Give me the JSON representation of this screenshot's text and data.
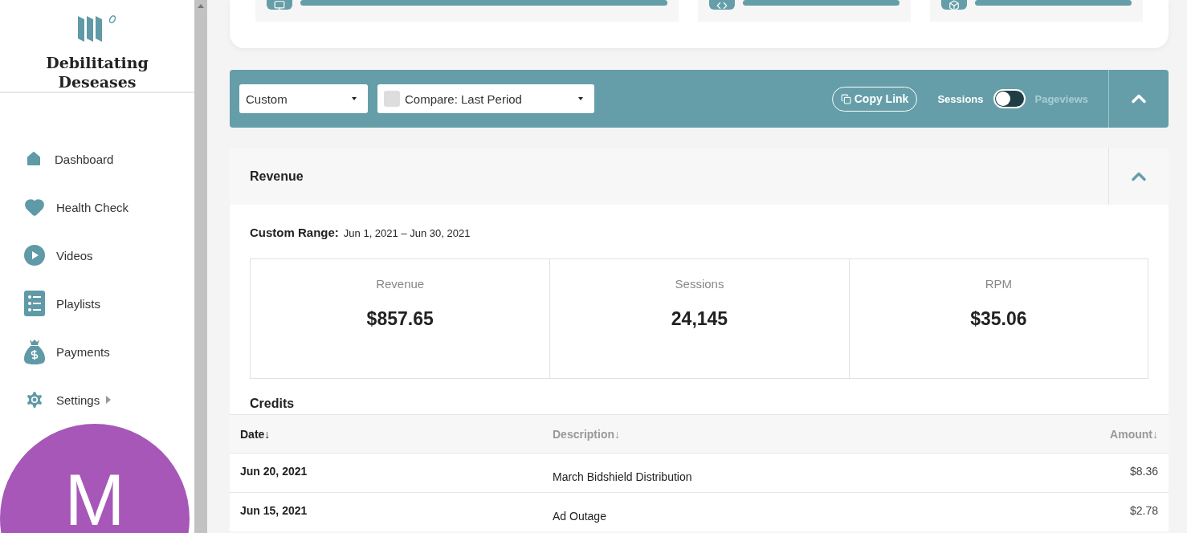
{
  "brand": {
    "name": "Debilitating Deseases"
  },
  "nav": [
    {
      "label": "Dashboard",
      "submenu": false
    },
    {
      "label": "Health Check",
      "submenu": false
    },
    {
      "label": "Videos",
      "submenu": false
    },
    {
      "label": "Playlists",
      "submenu": false
    },
    {
      "label": "Payments",
      "submenu": false
    },
    {
      "label": "Settings",
      "submenu": true
    }
  ],
  "avatar": {
    "initial": "M",
    "color": "#a657b8"
  },
  "top_cards": [
    {
      "kind": "monitor"
    },
    {
      "kind": "code"
    },
    {
      "kind": "box"
    }
  ],
  "toolbar": {
    "range": "Custom",
    "compare": {
      "label": "Compare: Last Period",
      "checked": false
    },
    "copy_link": "Copy Link",
    "toggle": {
      "left": "Sessions",
      "right": "Pageviews",
      "on": false
    }
  },
  "revenue": {
    "title": "Revenue",
    "range_label": "Custom Range:",
    "range": "Jun 1, 2021 – Jun 30, 2021",
    "stats": [
      {
        "label": "Revenue",
        "value": "$857.65"
      },
      {
        "label": "Sessions",
        "value": "24,145"
      },
      {
        "label": "RPM",
        "value": "$35.06"
      }
    ],
    "credits_title": "Credits",
    "columns": [
      {
        "label": "Date↓",
        "selected": true
      },
      {
        "label": "Description↓",
        "selected": false
      },
      {
        "label": "Amount↓",
        "selected": false
      }
    ],
    "rows": [
      [
        "Jun 20, 2021",
        "March Bidshield Distribution",
        "$8.36"
      ],
      [
        "Jun 15, 2021",
        "Ad Outage",
        "$2.78"
      ]
    ]
  }
}
